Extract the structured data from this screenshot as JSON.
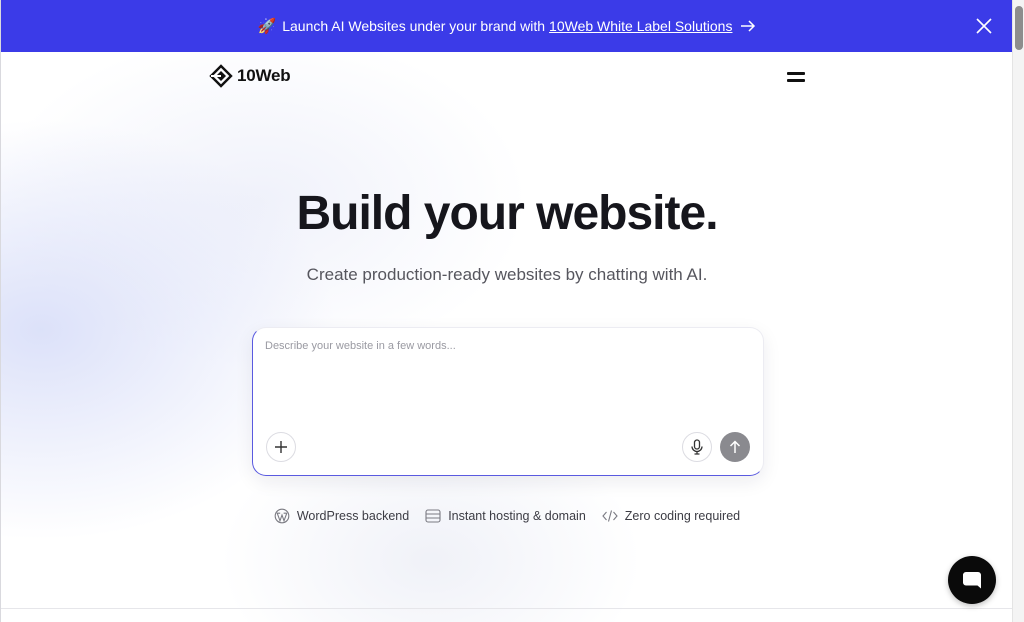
{
  "banner": {
    "rocket_glyph": "🚀",
    "text": "Launch AI Websites under your brand with",
    "link_text": "10Web White Label Solutions",
    "bg_color": "#3b3be8"
  },
  "header": {
    "logo_text": "10Web"
  },
  "hero": {
    "title": "Build your website.",
    "subtitle": "Create production-ready websites by chatting with AI."
  },
  "prompt": {
    "placeholder": "Describe your website in a few words..."
  },
  "features": [
    {
      "icon": "wordpress-icon",
      "label": "WordPress backend"
    },
    {
      "icon": "hosting-icon",
      "label": "Instant hosting & domain"
    },
    {
      "icon": "code-icon",
      "label": "Zero coding required"
    }
  ]
}
